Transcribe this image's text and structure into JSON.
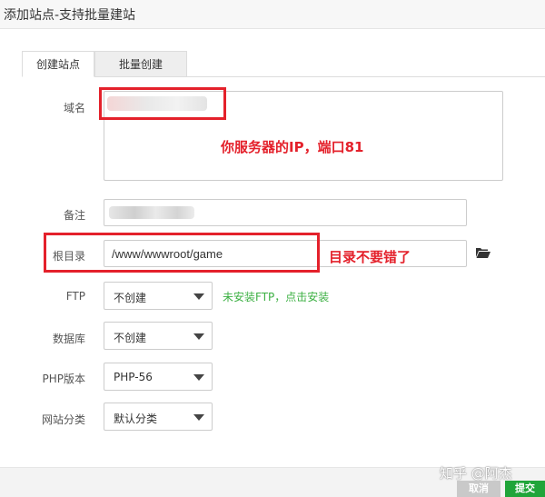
{
  "window": {
    "title": "添加站点-支持批量建站"
  },
  "tabs": [
    {
      "label": "创建站点"
    },
    {
      "label": "批量创建"
    }
  ],
  "form": {
    "domain": {
      "label": "域名",
      "value": ""
    },
    "remark": {
      "label": "备注",
      "value": ""
    },
    "root": {
      "label": "根目录",
      "value": "/www/wwwroot/game"
    },
    "ftp": {
      "label": "FTP",
      "selected": "不创建",
      "hint": "未安装FTP，点击安装"
    },
    "database": {
      "label": "数据库",
      "selected": "不创建"
    },
    "php": {
      "label": "PHP版本",
      "selected": "PHP-56"
    },
    "category": {
      "label": "网站分类",
      "selected": "默认分类"
    }
  },
  "annotations": {
    "domain_note": "你服务器的IP，端口81",
    "root_note": "目录不要错了"
  },
  "footer": {
    "watermark": "知乎 @阿杰",
    "cancel_label": "取消",
    "submit_label": "提交"
  },
  "colors": {
    "annotation_red": "#e4212b",
    "hint_green": "#3cb043",
    "submit_green": "#20a53a"
  },
  "icons": {
    "root_picker": "folder-open-icon"
  }
}
